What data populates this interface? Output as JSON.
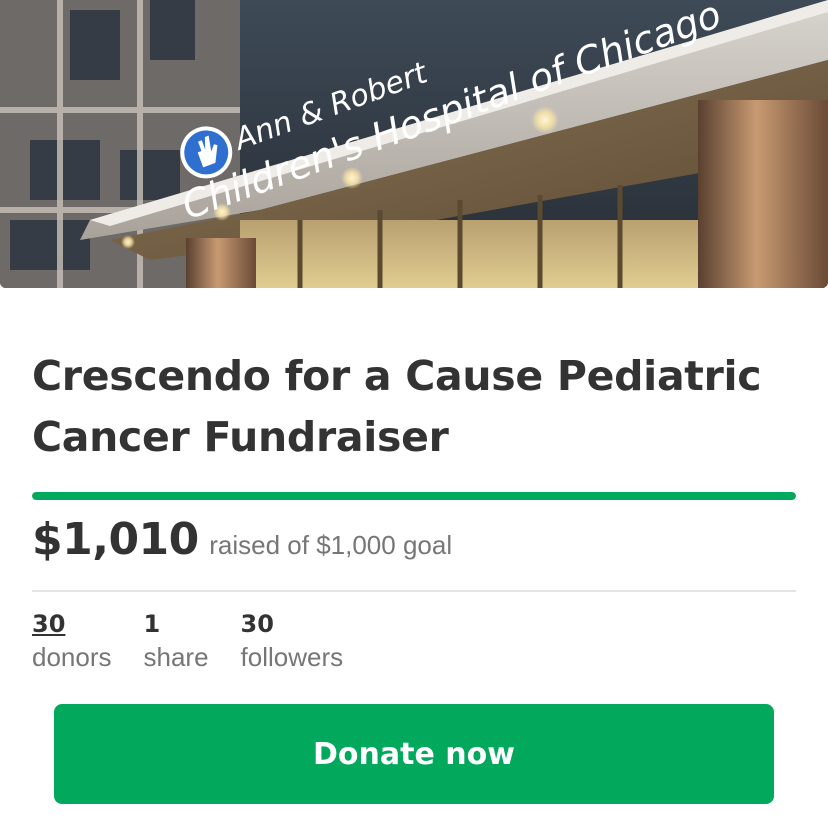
{
  "hero": {
    "image": "hospital-entrance-photo",
    "sign_line_1": "Ann & Robert",
    "sign_line_2": "Children's Hospital of Chicago"
  },
  "campaign": {
    "title": "Crescendo for a Cause Pediatric Cancer Fundraiser",
    "raised": "$1,010",
    "goal_text": "raised of $1,000 goal",
    "progress_fraction": 1.0
  },
  "stats": {
    "donors": {
      "count": "30",
      "label": "donors"
    },
    "shares": {
      "count": "1",
      "label": "share"
    },
    "followers": {
      "count": "30",
      "label": "followers"
    }
  },
  "actions": {
    "donate_label": "Donate now"
  },
  "colors": {
    "accent": "#02a95c",
    "text": "#333333",
    "muted": "#767676"
  }
}
